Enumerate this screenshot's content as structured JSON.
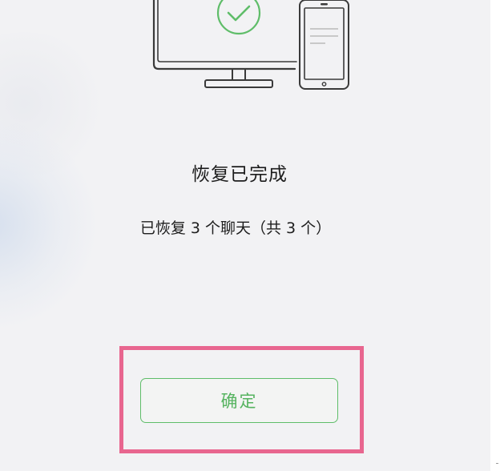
{
  "dialog": {
    "title": "恢复已完成",
    "message": "已恢复 3 个聊天（共 3 个）",
    "confirm_label": "确定"
  },
  "icons": {
    "status": "check-circle-icon",
    "illustration": "monitor-and-phone-illustration"
  },
  "colors": {
    "accent_green": "#5fbd69",
    "highlight_pink": "#e8668f",
    "background": "#f2f2f4",
    "text": "#1d1d1d"
  }
}
